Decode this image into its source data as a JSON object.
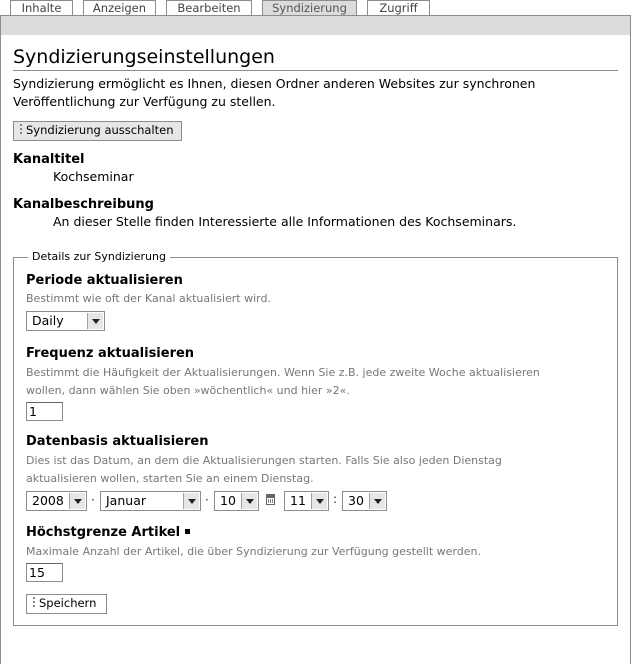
{
  "tabs": [
    {
      "label": "Inhalte"
    },
    {
      "label": "Anzeigen"
    },
    {
      "label": "Bearbeiten"
    },
    {
      "label": "Syndizierung",
      "active": true
    },
    {
      "label": "Zugriff"
    }
  ],
  "page": {
    "title": "Syndizierungseinstellungen",
    "intro": "Syndizierung ermöglicht es Ihnen, diesen Ordner anderen Websites zur synchronen Veröffentlichung zur Verfügung zu stellen.",
    "toggle_button": "Syndizierung ausschalten"
  },
  "channel": {
    "title_label": "Kanaltitel",
    "title_value": "Kochseminar",
    "desc_label": "Kanalbeschreibung",
    "desc_value": "An dieser Stelle finden Interessierte alle Informationen des Kochseminars."
  },
  "details": {
    "legend": "Details zur Syndizierung",
    "period": {
      "label": "Periode aktualisieren",
      "help": "Bestimmt wie oft der Kanal aktualisiert wird.",
      "value": "Daily"
    },
    "frequency": {
      "label": "Frequenz aktualisieren",
      "help": "Bestimmt die Häufigkeit der Aktualisierungen. Wenn Sie z.B. jede zweite Woche aktualisieren wollen, dann wählen Sie oben »wöchentlich« und hier »2«.",
      "value": "1"
    },
    "base": {
      "label": "Datenbasis aktualisieren",
      "help": "Dies ist das Datum, an dem die Aktualisierungen starten. Falls Sie also jeden Dienstag aktualisieren wollen, starten Sie an einem Dienstag.",
      "year": "2008",
      "month": "Januar",
      "day": "10",
      "hour": "11",
      "minute": "30",
      "sep_dot": "·",
      "sep_colon": ":"
    },
    "max_items": {
      "label": "Höchstgrenze Artikel",
      "help": "Maximale Anzahl der Artikel, die über Syndizierung zur Verfügung gestellt werden.",
      "value": "15"
    },
    "save_button": "Speichern"
  }
}
